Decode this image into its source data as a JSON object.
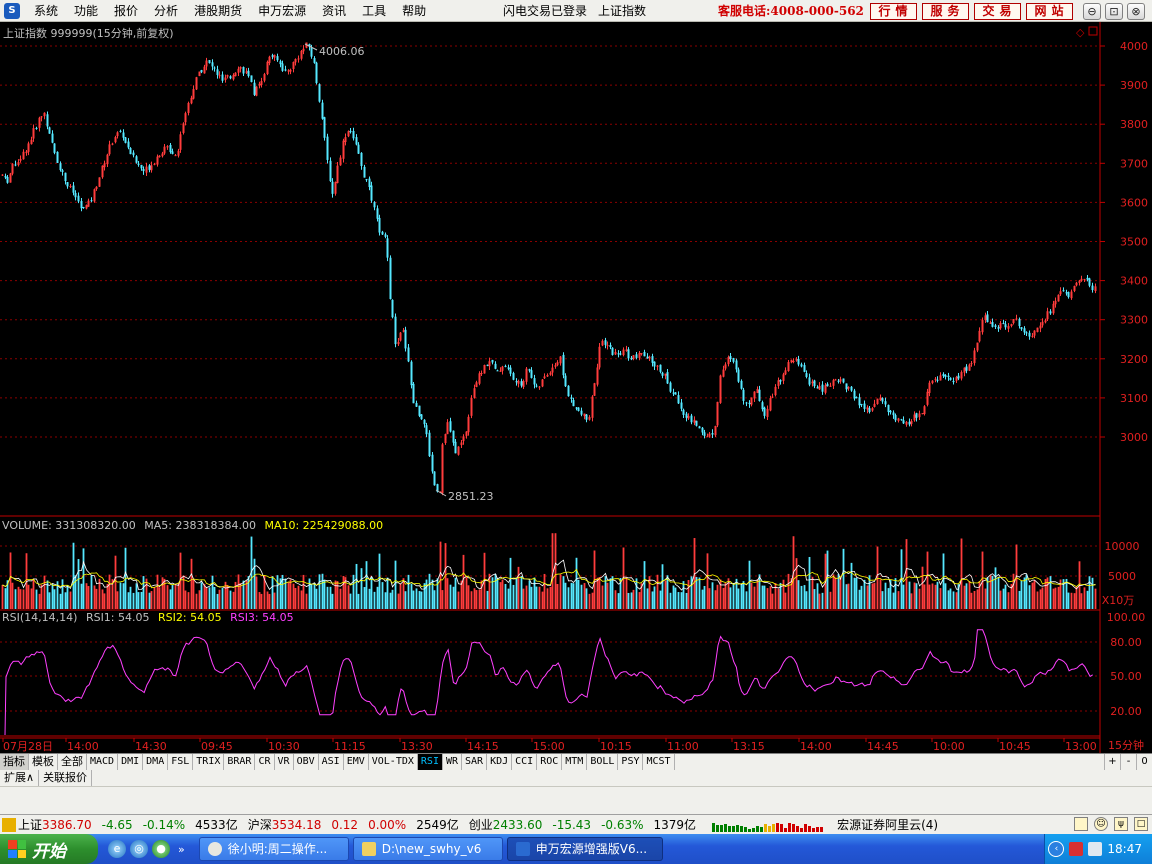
{
  "menu": {
    "app_icon": "S",
    "items": [
      "系统",
      "功能",
      "报价",
      "分析",
      "港股期货",
      "申万宏源",
      "资讯",
      "工具",
      "帮助"
    ],
    "login_status": "闪电交易已登录",
    "index_name": "上证指数",
    "hotline": "客服电话:4008-000-562",
    "quick_buttons": [
      "行情",
      "服务",
      "交易",
      "网站"
    ],
    "window_buttons": [
      "⊖",
      "⊡",
      "⊗"
    ]
  },
  "chart": {
    "title": "上证指数 999999(15分钟,前复权)",
    "high_label": "4006.06",
    "low_label": "2851.23",
    "price_ticks": [
      "4000",
      "3900",
      "3800",
      "3700",
      "3600",
      "3500",
      "3400",
      "3300",
      "3200",
      "3100",
      "3000"
    ],
    "volume_info": {
      "label": "VOLUME: 331308320.00",
      "ma5": "MA5: 238318384.00",
      "ma10": "MA10: 225429088.00"
    },
    "volume_ticks": [
      "10000",
      "5000"
    ],
    "volume_unit": "X10万",
    "rsi_info": {
      "label": "RSI(14,14,14)",
      "rsi1": "RSI1: 54.05",
      "rsi2": "RSI2: 54.05",
      "rsi3": "RSI3: 54.05"
    },
    "rsi_ticks": [
      "100.00",
      "80.00",
      "50.00",
      "20.00"
    ],
    "time_labels": [
      "07月28日",
      "14:00",
      "14:30",
      "09:45",
      "10:30",
      "11:15",
      "13:30",
      "14:15",
      "15:00",
      "10:15",
      "11:00",
      "13:15",
      "14:00",
      "14:45",
      "10:00",
      "10:45",
      "13:00"
    ],
    "period": "15分钟",
    "colors": {
      "up": "#ff3c3c",
      "down": "#55e8ff",
      "grid": "#8b0000",
      "axis": "#c00000",
      "ma5": "#ffffff",
      "ma10": "#ffff00",
      "rsi": "#ff40ff",
      "label": "#c0c0c0"
    }
  },
  "chart_data": {
    "type": "candlestick",
    "title": "上证指数 999999(15分钟,前复权)",
    "ylim": [
      2851.23,
      4006.06
    ],
    "y_ticks": [
      3000,
      3100,
      3200,
      3300,
      3400,
      3500,
      3600,
      3700,
      3800,
      3900,
      4000
    ],
    "high": 4006.06,
    "low": 2851.23,
    "close_path": [
      [
        0,
        3680
      ],
      [
        6,
        3650
      ],
      [
        14,
        3700
      ],
      [
        22,
        3720
      ],
      [
        30,
        3760
      ],
      [
        38,
        3810
      ],
      [
        44,
        3830
      ],
      [
        50,
        3760
      ],
      [
        58,
        3700
      ],
      [
        66,
        3650
      ],
      [
        74,
        3620
      ],
      [
        82,
        3580
      ],
      [
        90,
        3600
      ],
      [
        98,
        3660
      ],
      [
        106,
        3720
      ],
      [
        114,
        3770
      ],
      [
        120,
        3780
      ],
      [
        128,
        3740
      ],
      [
        136,
        3700
      ],
      [
        144,
        3680
      ],
      [
        152,
        3700
      ],
      [
        160,
        3730
      ],
      [
        168,
        3740
      ],
      [
        176,
        3720
      ],
      [
        182,
        3800
      ],
      [
        190,
        3870
      ],
      [
        198,
        3930
      ],
      [
        206,
        3960
      ],
      [
        214,
        3940
      ],
      [
        222,
        3910
      ],
      [
        230,
        3920
      ],
      [
        238,
        3950
      ],
      [
        246,
        3930
      ],
      [
        254,
        3880
      ],
      [
        262,
        3920
      ],
      [
        270,
        3980
      ],
      [
        278,
        3960
      ],
      [
        286,
        3930
      ],
      [
        294,
        3960
      ],
      [
        302,
        3990
      ],
      [
        308,
        4006
      ],
      [
        314,
        3950
      ],
      [
        320,
        3850
      ],
      [
        326,
        3720
      ],
      [
        332,
        3620
      ],
      [
        338,
        3700
      ],
      [
        344,
        3770
      ],
      [
        350,
        3790
      ],
      [
        356,
        3740
      ],
      [
        362,
        3680
      ],
      [
        368,
        3640
      ],
      [
        374,
        3580
      ],
      [
        380,
        3520
      ],
      [
        386,
        3500
      ],
      [
        390,
        3350
      ],
      [
        396,
        3220
      ],
      [
        402,
        3280
      ],
      [
        408,
        3200
      ],
      [
        412,
        3100
      ],
      [
        418,
        3060
      ],
      [
        424,
        3040
      ],
      [
        430,
        2940
      ],
      [
        436,
        2851
      ],
      [
        442,
        2980
      ],
      [
        448,
        3040
      ],
      [
        454,
        2960
      ],
      [
        460,
        2980
      ],
      [
        466,
        3020
      ],
      [
        472,
        3120
      ],
      [
        478,
        3150
      ],
      [
        484,
        3180
      ],
      [
        490,
        3200
      ],
      [
        496,
        3160
      ],
      [
        504,
        3190
      ],
      [
        512,
        3150
      ],
      [
        520,
        3130
      ],
      [
        528,
        3180
      ],
      [
        536,
        3120
      ],
      [
        544,
        3150
      ],
      [
        552,
        3180
      ],
      [
        560,
        3200
      ],
      [
        566,
        3120
      ],
      [
        572,
        3080
      ],
      [
        580,
        3060
      ],
      [
        588,
        3040
      ],
      [
        594,
        3140
      ],
      [
        600,
        3240
      ],
      [
        608,
        3230
      ],
      [
        616,
        3210
      ],
      [
        624,
        3220
      ],
      [
        632,
        3200
      ],
      [
        640,
        3210
      ],
      [
        648,
        3200
      ],
      [
        656,
        3180
      ],
      [
        664,
        3160
      ],
      [
        670,
        3120
      ],
      [
        676,
        3100
      ],
      [
        684,
        3060
      ],
      [
        692,
        3040
      ],
      [
        700,
        3020
      ],
      [
        708,
        3000
      ],
      [
        714,
        3020
      ],
      [
        720,
        3160
      ],
      [
        728,
        3200
      ],
      [
        736,
        3180
      ],
      [
        742,
        3100
      ],
      [
        748,
        3090
      ],
      [
        756,
        3120
      ],
      [
        764,
        3060
      ],
      [
        770,
        3100
      ],
      [
        778,
        3140
      ],
      [
        786,
        3180
      ],
      [
        794,
        3200
      ],
      [
        800,
        3180
      ],
      [
        806,
        3150
      ],
      [
        814,
        3130
      ],
      [
        822,
        3120
      ],
      [
        830,
        3140
      ],
      [
        838,
        3150
      ],
      [
        846,
        3130
      ],
      [
        854,
        3100
      ],
      [
        862,
        3080
      ],
      [
        870,
        3060
      ],
      [
        878,
        3100
      ],
      [
        884,
        3090
      ],
      [
        890,
        3060
      ],
      [
        898,
        3040
      ],
      [
        906,
        3030
      ],
      [
        914,
        3050
      ],
      [
        922,
        3060
      ],
      [
        930,
        3140
      ],
      [
        938,
        3150
      ],
      [
        946,
        3160
      ],
      [
        954,
        3140
      ],
      [
        962,
        3170
      ],
      [
        970,
        3180
      ],
      [
        978,
        3260
      ],
      [
        984,
        3310
      ],
      [
        990,
        3290
      ],
      [
        998,
        3280
      ],
      [
        1006,
        3290
      ],
      [
        1014,
        3300
      ],
      [
        1022,
        3280
      ],
      [
        1030,
        3260
      ],
      [
        1038,
        3290
      ],
      [
        1046,
        3310
      ],
      [
        1054,
        3340
      ],
      [
        1062,
        3380
      ],
      [
        1070,
        3360
      ],
      [
        1078,
        3400
      ],
      [
        1084,
        3410
      ],
      [
        1090,
        3380
      ],
      [
        1096,
        3390
      ]
    ]
  }
}
